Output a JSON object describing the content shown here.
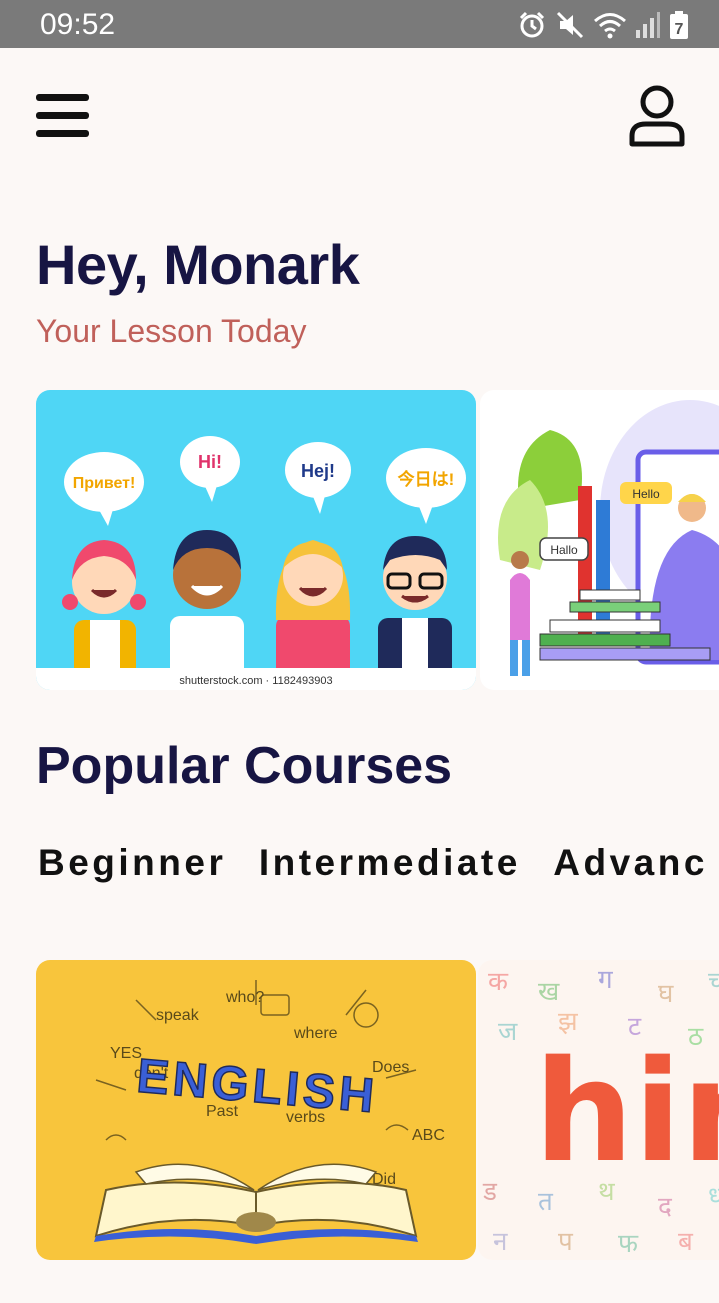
{
  "status": {
    "time": "09:52",
    "battery": "7"
  },
  "header": {
    "menu_icon": "hamburger-menu-icon",
    "profile_icon": "user-profile-icon"
  },
  "greeting": "Hey, Monark",
  "subtitle": "Your Lesson Today",
  "lessons": {
    "card1": {
      "bubbles": [
        "Привет!",
        "Hi!",
        "Hej!",
        "今日は!"
      ],
      "credit": "shutterstock.com · 1182493903"
    },
    "card2": {
      "bubbles": [
        "Hello",
        "Hallo"
      ]
    }
  },
  "popular": {
    "title": "Popular Courses",
    "tabs": [
      "Beginner",
      "Intermediate",
      "Advanc"
    ]
  },
  "courses": {
    "card1": {
      "title": "ENGLISH",
      "doodles": [
        "YES",
        "speak",
        "don't",
        "who?",
        "where",
        "verbs",
        "Past",
        "Does",
        "Did",
        "ABC"
      ]
    },
    "card2": {
      "title": "hin"
    }
  },
  "colors": {
    "background": "#fcf8f6",
    "heading": "#171543",
    "subtitle": "#c0605a",
    "status_bar": "#7a7a7a",
    "lesson_card_bg": "#4fd6f5",
    "english_card_bg": "#f8c53c"
  }
}
